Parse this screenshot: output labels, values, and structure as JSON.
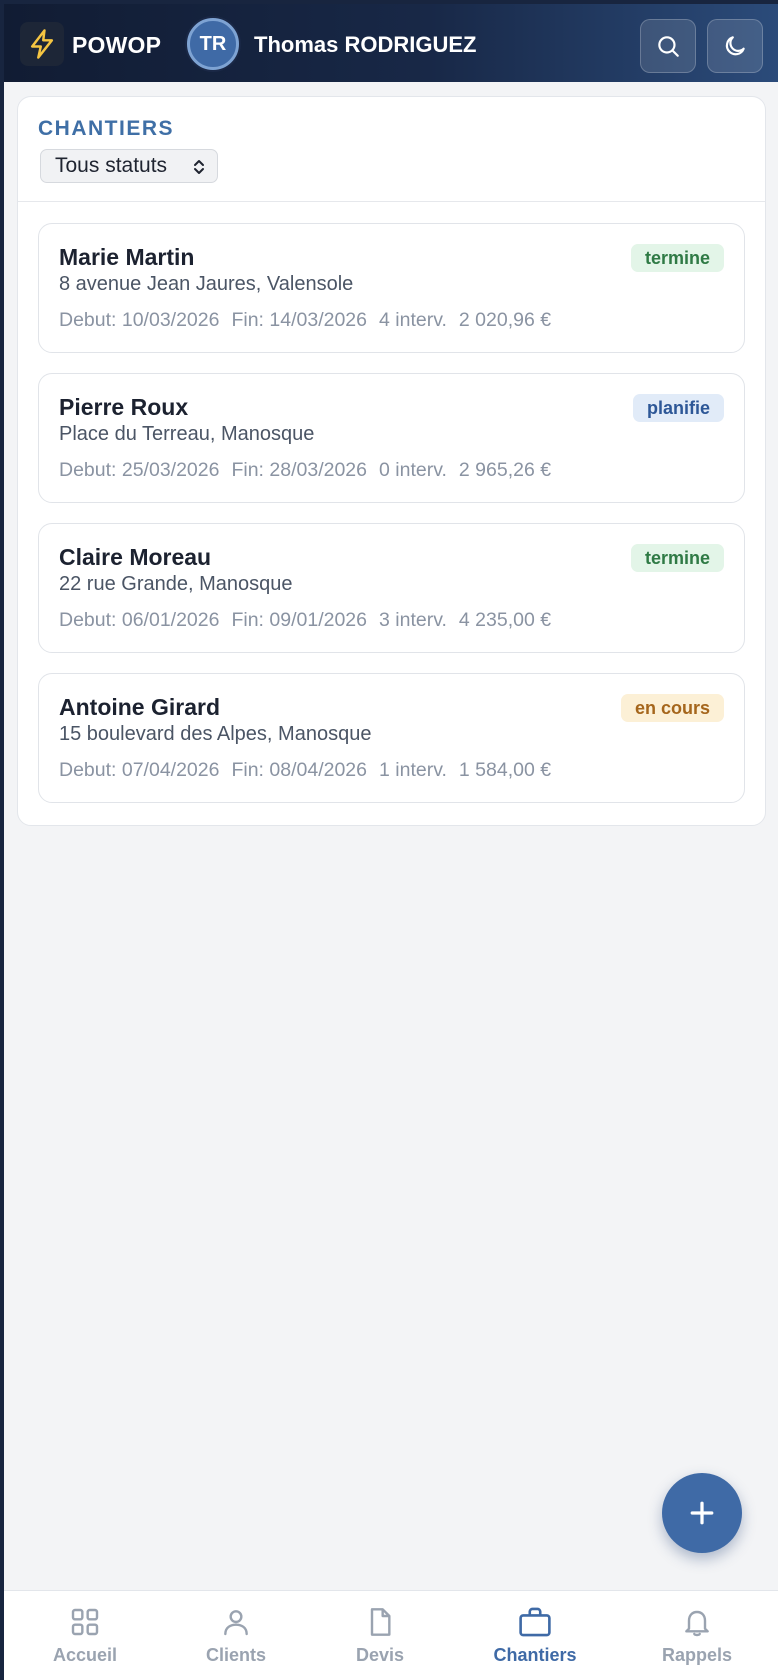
{
  "app": {
    "brand": "POWOP",
    "user_initials": "TR",
    "user_name": "Thomas RODRIGUEZ"
  },
  "section": {
    "title": "CHANTIERS",
    "filter_value": "Tous statuts"
  },
  "chantiers": [
    {
      "name": "Marie Martin",
      "address": "8 avenue Jean Jaures, Valensole",
      "start": "Debut: 10/03/2026",
      "end": "Fin: 14/03/2026",
      "interventions": "4 interv.",
      "amount": "2 020,96 €",
      "status": "termine",
      "status_bg": "#e3f5e8",
      "status_fg": "#2f7a45"
    },
    {
      "name": "Pierre Roux",
      "address": "Place du Terreau, Manosque",
      "start": "Debut: 25/03/2026",
      "end": "Fin: 28/03/2026",
      "interventions": "0 interv.",
      "amount": "2 965,26 €",
      "status": "planifie",
      "status_bg": "#e1ebf8",
      "status_fg": "#2d5797"
    },
    {
      "name": "Claire Moreau",
      "address": "22 rue Grande, Manosque",
      "start": "Debut: 06/01/2026",
      "end": "Fin: 09/01/2026",
      "interventions": "3 interv.",
      "amount": "4 235,00 €",
      "status": "termine",
      "status_bg": "#e3f5e8",
      "status_fg": "#2f7a45"
    },
    {
      "name": "Antoine Girard",
      "address": "15 boulevard des Alpes, Manosque",
      "start": "Debut: 07/04/2026",
      "end": "Fin: 08/04/2026",
      "interventions": "1 interv.",
      "amount": "1 584,00 €",
      "status": "en cours",
      "status_bg": "#fcf0d6",
      "status_fg": "#a5661c"
    }
  ],
  "nav": [
    {
      "label": "Accueil",
      "icon": "grid-icon"
    },
    {
      "label": "Clients",
      "icon": "user-icon"
    },
    {
      "label": "Devis",
      "icon": "document-icon"
    },
    {
      "label": "Chantiers",
      "icon": "briefcase-icon",
      "active": true
    },
    {
      "label": "Rappels",
      "icon": "bell-icon"
    }
  ],
  "colors": {
    "accent": "#3f6aa6",
    "header_dark": "#111c33",
    "inactive_nav": "#9aa3b0"
  }
}
